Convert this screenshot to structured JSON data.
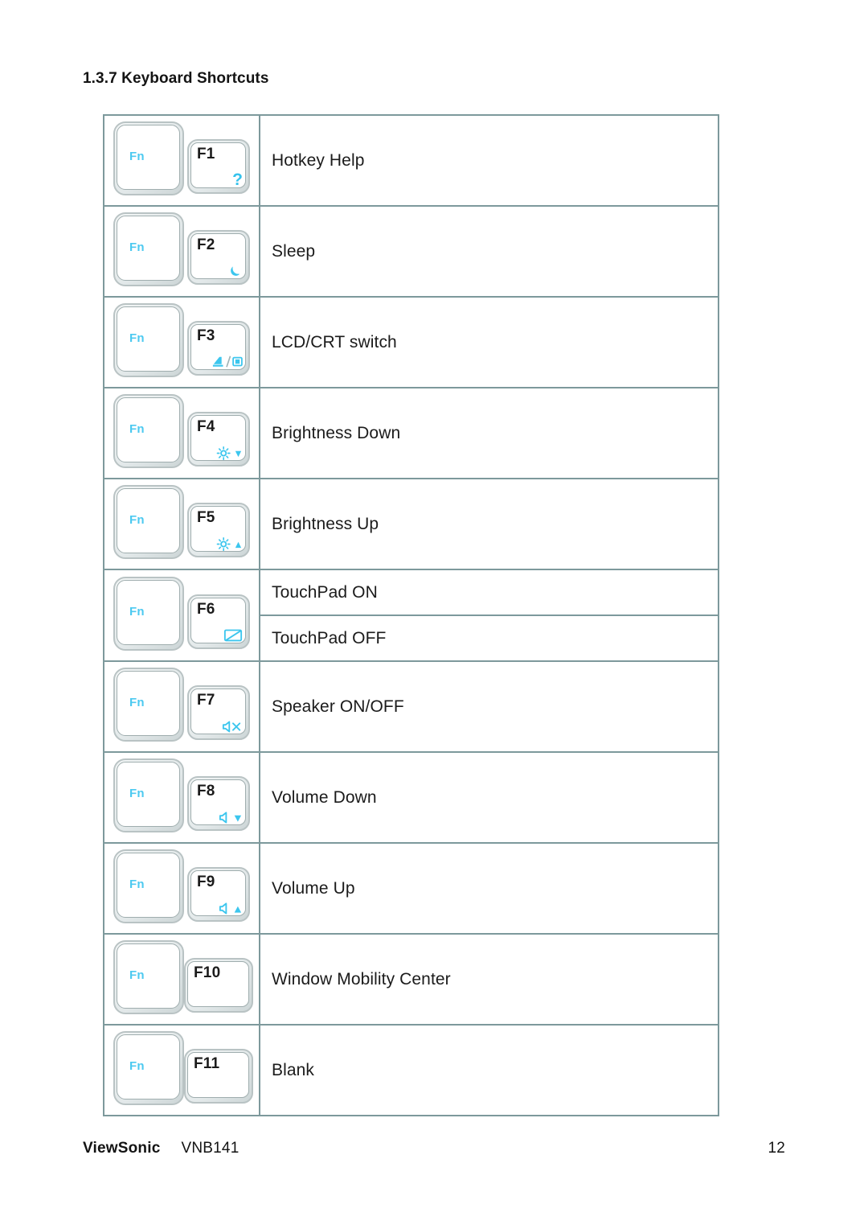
{
  "page": {
    "heading": "1.3.7 Keyboard Shortcuts",
    "accent_color": "#3cc6ee",
    "border_color": "#7d999c"
  },
  "table": {
    "modifier_key_label": "Fn",
    "rows": [
      {
        "fn": "Fn",
        "fkey": "F1",
        "glyph": "question-mark-icon",
        "labels": [
          "Hotkey Help"
        ]
      },
      {
        "fn": "Fn",
        "fkey": "F2",
        "glyph": "moon-icon",
        "labels": [
          "Sleep"
        ]
      },
      {
        "fn": "Fn",
        "fkey": "F3",
        "glyph": "lcd-crt-switch-icon",
        "labels": [
          "LCD/CRT switch"
        ]
      },
      {
        "fn": "Fn",
        "fkey": "F4",
        "glyph": "brightness-down-icon",
        "labels": [
          "Brightness Down"
        ]
      },
      {
        "fn": "Fn",
        "fkey": "F5",
        "glyph": "brightness-up-icon",
        "labels": [
          "Brightness Up"
        ]
      },
      {
        "fn": "Fn",
        "fkey": "F6",
        "glyph": "touchpad-toggle-icon",
        "labels": [
          "TouchPad ON",
          "TouchPad OFF"
        ]
      },
      {
        "fn": "Fn",
        "fkey": "F7",
        "glyph": "speaker-mute-icon",
        "labels": [
          "Speaker ON/OFF"
        ]
      },
      {
        "fn": "Fn",
        "fkey": "F8",
        "glyph": "volume-down-icon",
        "labels": [
          "Volume Down"
        ]
      },
      {
        "fn": "Fn",
        "fkey": "F9",
        "glyph": "volume-up-icon",
        "labels": [
          "Volume Up"
        ]
      },
      {
        "fn": "Fn",
        "fkey": "F10",
        "glyph": "",
        "labels": [
          "Window Mobility Center"
        ]
      },
      {
        "fn": "Fn",
        "fkey": "F11",
        "glyph": "",
        "labels": [
          "Blank"
        ]
      }
    ]
  },
  "footer": {
    "brand": "ViewSonic",
    "model": "VNB141",
    "page_number": "12"
  }
}
